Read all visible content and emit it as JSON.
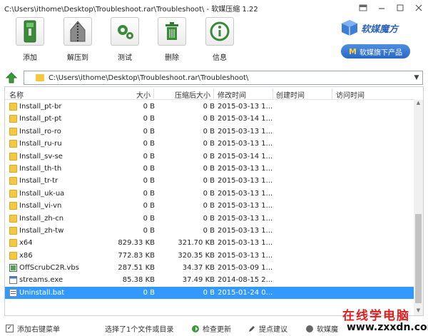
{
  "window": {
    "title": "C:\\Users\\ithome\\Desktop\\Troubleshoot.rar\\Troubleshoot\\ - 软媒压缩 1.22"
  },
  "toolbar": {
    "add_label": "添加",
    "extract_label": "解压到",
    "test_label": "测试",
    "delete_label": "删除",
    "info_label": "信息"
  },
  "brand": {
    "logo_text": "软媒魔方",
    "products_button": "软媒旗下产品",
    "products_button_icon_letter": "M"
  },
  "address": {
    "path": "C:\\Users\\ithome\\Desktop\\Troubleshoot.rar\\Troubleshoot\\"
  },
  "columns": {
    "name": "名称",
    "size": "大小",
    "packed": "压缩后大小",
    "modified": "修改时间",
    "created": "创建时间",
    "accessed": "访问时间"
  },
  "files": [
    {
      "name": "Install_pt-br",
      "size": "0 B",
      "packed": "0 B",
      "modified": "2015-03-13 1...",
      "type": "folder"
    },
    {
      "name": "Install_pt-pt",
      "size": "0 B",
      "packed": "0 B",
      "modified": "2015-03-14 1...",
      "type": "folder"
    },
    {
      "name": "Install_ro-ro",
      "size": "0 B",
      "packed": "0 B",
      "modified": "2015-03-13 1...",
      "type": "folder"
    },
    {
      "name": "Install_ru-ru",
      "size": "0 B",
      "packed": "0 B",
      "modified": "2015-03-13 1...",
      "type": "folder"
    },
    {
      "name": "Install_sv-se",
      "size": "0 B",
      "packed": "0 B",
      "modified": "2015-03-14 1...",
      "type": "folder"
    },
    {
      "name": "Install_th-th",
      "size": "0 B",
      "packed": "0 B",
      "modified": "2015-03-13 1...",
      "type": "folder"
    },
    {
      "name": "Install_tr-tr",
      "size": "0 B",
      "packed": "0 B",
      "modified": "2015-03-13 1...",
      "type": "folder"
    },
    {
      "name": "Install_uk-ua",
      "size": "0 B",
      "packed": "0 B",
      "modified": "2015-03-13 1...",
      "type": "folder"
    },
    {
      "name": "Install_vi-vn",
      "size": "0 B",
      "packed": "0 B",
      "modified": "2015-03-13 1...",
      "type": "folder"
    },
    {
      "name": "Install_zh-cn",
      "size": "0 B",
      "packed": "0 B",
      "modified": "2015-03-13 1...",
      "type": "folder"
    },
    {
      "name": "Install_zh-tw",
      "size": "0 B",
      "packed": "0 B",
      "modified": "2015-03-13 1...",
      "type": "folder"
    },
    {
      "name": "x64",
      "size": "829.33 KB",
      "packed": "321.70 KB",
      "modified": "2015-03-13 1...",
      "type": "folder"
    },
    {
      "name": "x86",
      "size": "772.83 KB",
      "packed": "320.35 KB",
      "modified": "2015-03-13 1...",
      "type": "folder"
    },
    {
      "name": "OffScrubC2R.vbs",
      "size": "287.51 KB",
      "packed": "34.37 KB",
      "modified": "2015-03-09 1...",
      "type": "script"
    },
    {
      "name": "streams.exe",
      "size": "85.38 KB",
      "packed": "37.49 KB",
      "modified": "2014-08-15 2...",
      "type": "exe"
    },
    {
      "name": "Uninstall.bat",
      "size": "0 B",
      "packed": "0 B",
      "modified": "2015-01-24 0...",
      "type": "bat",
      "selected": true
    }
  ],
  "status": {
    "context_menu_label": "添加右键菜单",
    "context_menu_checked": true,
    "selection_text": "选择了1个文件或目录",
    "check_update": "检查更新",
    "suggest": "提点建议",
    "softmedia": "软媒魔"
  },
  "watermark": {
    "line1": "在线学电脑",
    "line2": "www.zxxdn.com"
  },
  "colors": {
    "selection": "#3399ff",
    "brand_blue": "#2a68c4",
    "folder": "#f4c842"
  }
}
